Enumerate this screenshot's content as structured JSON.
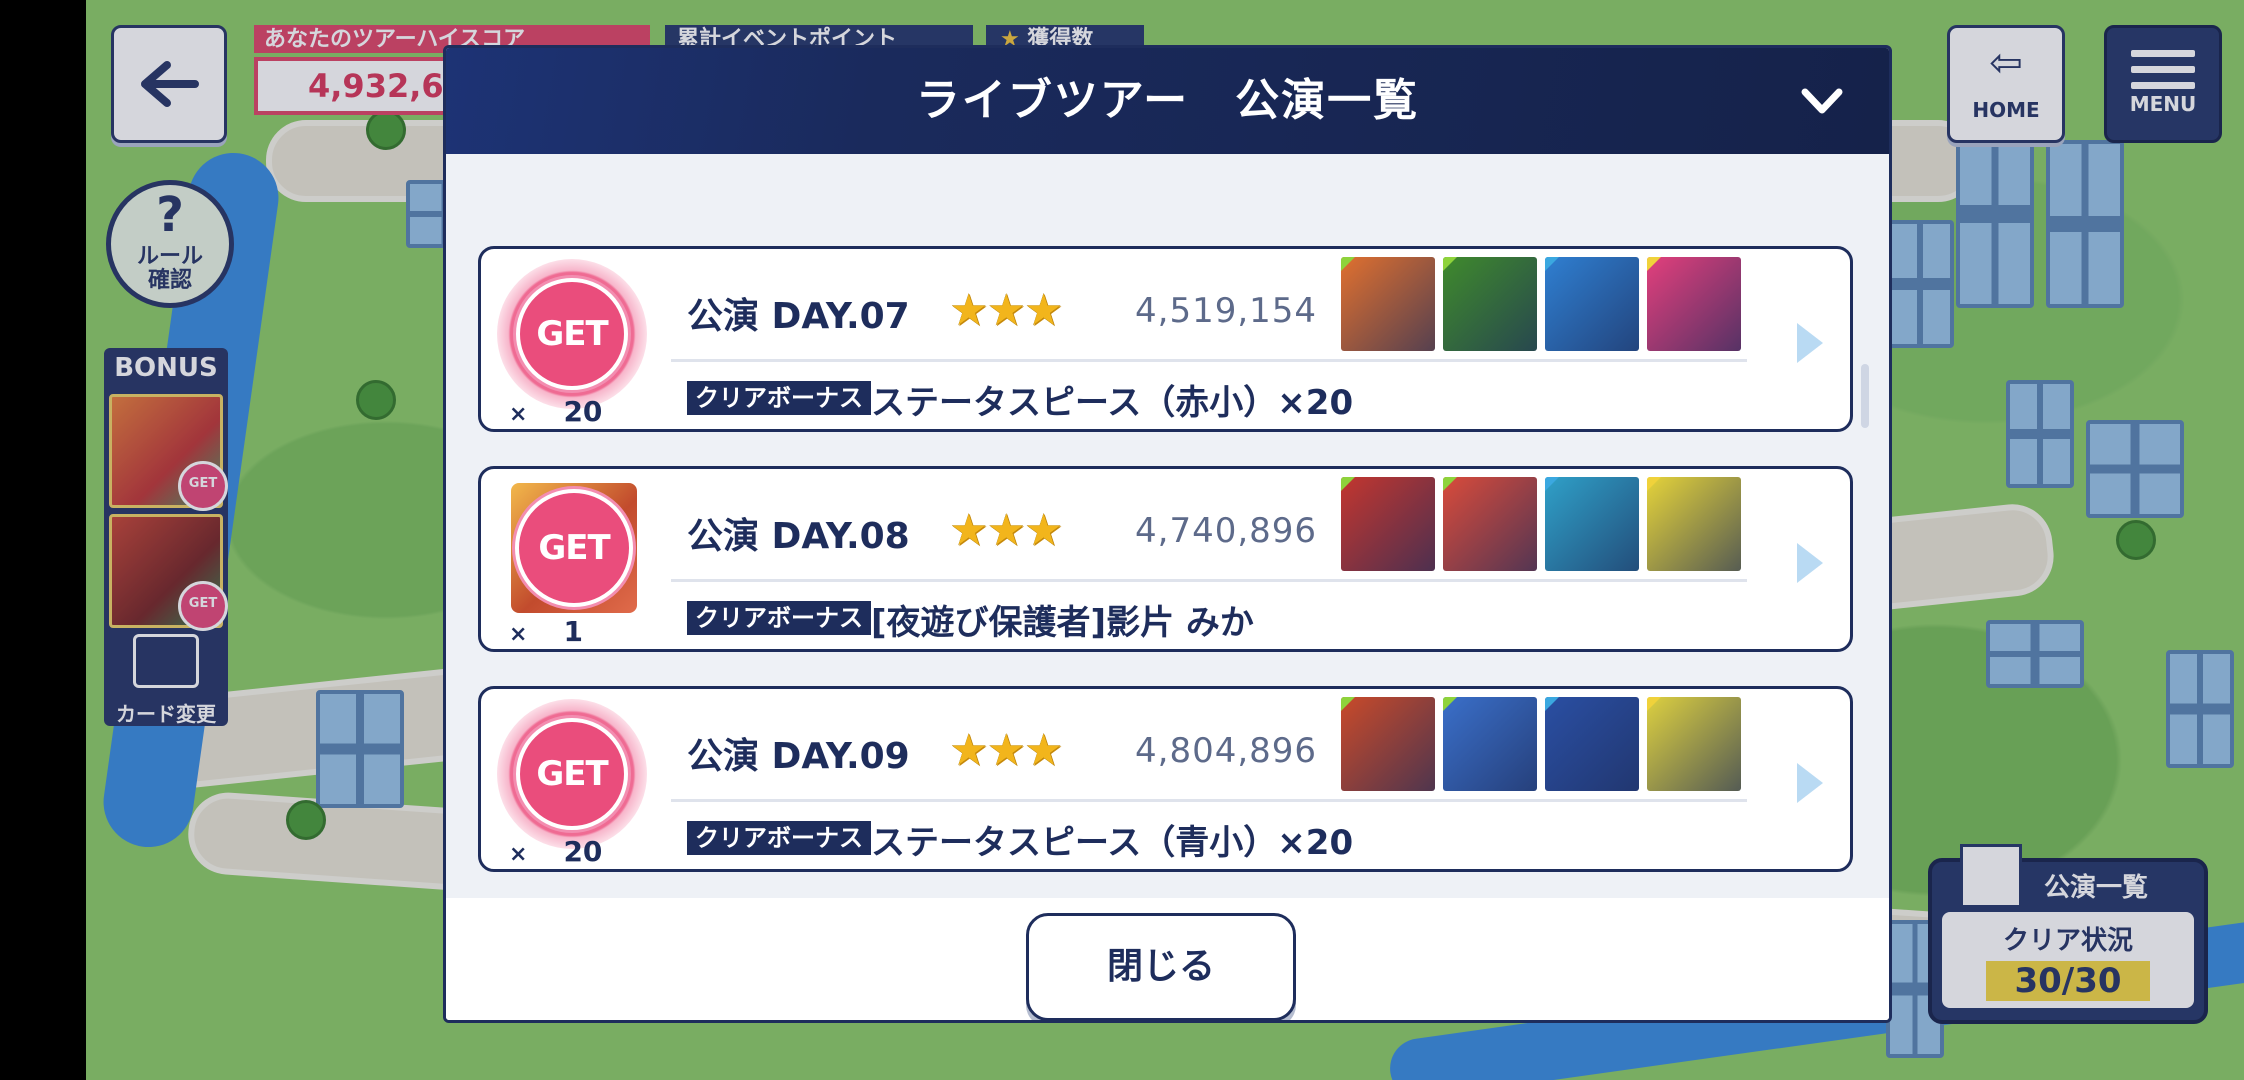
{
  "hud": {
    "highscore_label": "あなたのツアーハイスコア",
    "highscore_value": "4,932,6",
    "event_points_label": "累計イベントポイント",
    "stars_label": "獲得数",
    "rule_q": "?",
    "rule_label": "ルール\n確認",
    "bonus_title": "BONUS",
    "card_change": "カード変更",
    "home_label": "HOME",
    "menu_label": "MENU",
    "clear_header": "公演一覧",
    "clear_label": "クリア状況",
    "clear_value": "30/30"
  },
  "modal": {
    "title": "ライブツアー　公演一覧",
    "close_label": "閉じる",
    "rows": [
      {
        "get": "GET",
        "qty_x": "×",
        "qty": "20",
        "day": "公演 DAY.07",
        "stars": "★★★",
        "score": "4,519,154",
        "bonus_tag": "クリアボーナス",
        "bonus": "ステータスピース（赤小）×20",
        "thumb_colors": [
          "#e0702f",
          "#3f8a2c",
          "#2f7fd1",
          "#e23f7c"
        ]
      },
      {
        "get": "GET",
        "qty_x": "×",
        "qty": "1",
        "day": "公演 DAY.08",
        "stars": "★★★",
        "score": "4,740,896",
        "bonus_tag": "クリアボーナス",
        "bonus": "[夜遊び保護者]影片 みか",
        "thumb_colors": [
          "#c3362f",
          "#d94b3b",
          "#2fa0c8",
          "#e5d33a"
        ]
      },
      {
        "get": "GET",
        "qty_x": "×",
        "qty": "20",
        "day": "公演 DAY.09",
        "stars": "★★★",
        "score": "4,804,896",
        "bonus_tag": "クリアボーナス",
        "bonus": "ステータスピース（青小）×20",
        "thumb_colors": [
          "#c94a2a",
          "#3a6fc9",
          "#2a4fa3",
          "#ddd040"
        ]
      }
    ]
  },
  "colors": {
    "navy": "#1e2d5c",
    "pink": "#ea4d7c",
    "star": "#f2b51c"
  }
}
